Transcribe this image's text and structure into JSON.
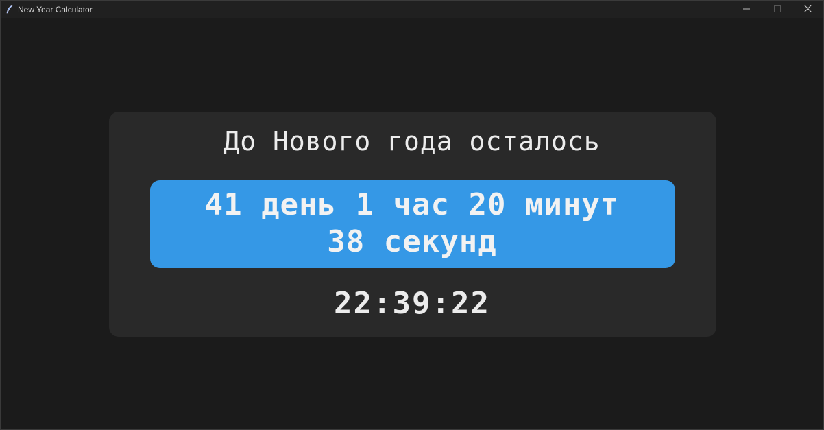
{
  "window": {
    "title": "New Year Calculator",
    "icon": "feather-icon",
    "controls": [
      "minimize-icon",
      "maximize-icon",
      "close-icon"
    ]
  },
  "content": {
    "headline": "До Нового года осталось",
    "countdown_line1": "41 день 1 час 20 минут",
    "countdown_line2": "38 секунд",
    "clock": "22:39:22"
  },
  "colors": {
    "background": "#1b1b1b",
    "card": "#292929",
    "accent": "#3598e6",
    "text": "#ececec"
  }
}
